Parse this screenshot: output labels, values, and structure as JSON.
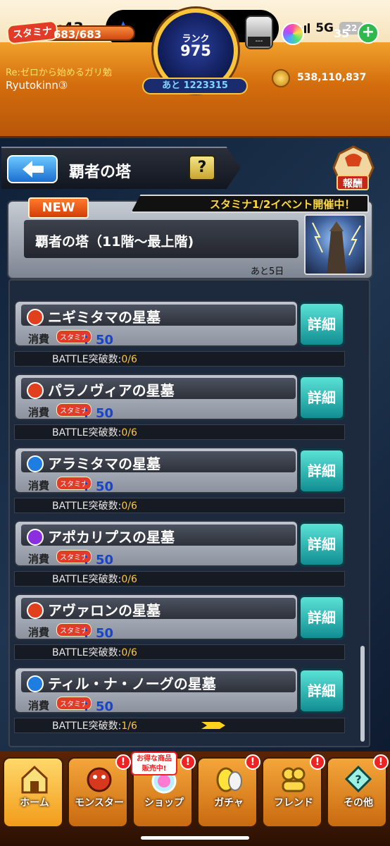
{
  "status_bar": {
    "time": "21:43",
    "network": "5G",
    "battery": "22"
  },
  "top_bar": {
    "stamina_label": "スタミナ",
    "stamina_value": "683/683",
    "rank_label": "ランク",
    "rank_value": "975",
    "rank_next": "あと 1223315",
    "chest_text": "---",
    "orb_count": "35",
    "plus_label": "+",
    "user_title": "Re:ゼロから始めるガリ勉",
    "user_name": "Ryutokinn③",
    "coin_count": "538,110,837"
  },
  "header": {
    "title": "覇者の塔",
    "help_label": "?",
    "reward_label": "報酬"
  },
  "quest": {
    "new_label": "NEW",
    "event_text": "スタミナ1/2イベント開催中！",
    "title": "覇者の塔（11階～最上階)",
    "remaining": "あと5日"
  },
  "stages": [
    {
      "name": "ニギミタマの星墓",
      "cost_label": "消費",
      "stamina_label": "スタミナ",
      "cost": "：50",
      "battle_label": "BATTLE突破数:",
      "battle_count": "0/6",
      "detail_label": "詳細",
      "element_color": "#e0401e"
    },
    {
      "name": "パラノヴィアの星墓",
      "cost_label": "消費",
      "stamina_label": "スタミナ",
      "cost": "：50",
      "battle_label": "BATTLE突破数:",
      "battle_count": "0/6",
      "detail_label": "詳細",
      "element_color": "#e0401e"
    },
    {
      "name": "アラミタマの星墓",
      "cost_label": "消費",
      "stamina_label": "スタミナ",
      "cost": "：50",
      "battle_label": "BATTLE突破数:",
      "battle_count": "0/6",
      "detail_label": "詳細",
      "element_color": "#1e7de0"
    },
    {
      "name": "アポカリプスの星墓",
      "cost_label": "消費",
      "stamina_label": "スタミナ",
      "cost": "：50",
      "battle_label": "BATTLE突破数:",
      "battle_count": "0/6",
      "detail_label": "詳細",
      "element_color": "#8a2ee0"
    },
    {
      "name": "アヴァロンの星墓",
      "cost_label": "消費",
      "stamina_label": "スタミナ",
      "cost": "：50",
      "battle_label": "BATTLE突破数:",
      "battle_count": "0/6",
      "detail_label": "詳細",
      "element_color": "#e0401e"
    },
    {
      "name": "ティル・ナ・ノーグの星墓",
      "cost_label": "消費",
      "stamina_label": "スタミナ",
      "cost": "：50",
      "battle_label": "BATTLE突破数:",
      "battle_count": "1/6",
      "detail_label": "詳細",
      "element_color": "#1e7de0"
    }
  ],
  "nav": {
    "home": "ホーム",
    "monster": "モンスター",
    "shop": "ショップ",
    "gacha": "ガチャ",
    "friend": "フレンド",
    "other": "その他",
    "shop_promo_line1": "お得な商品",
    "shop_promo_line2": "販売中!",
    "alert": "!"
  }
}
